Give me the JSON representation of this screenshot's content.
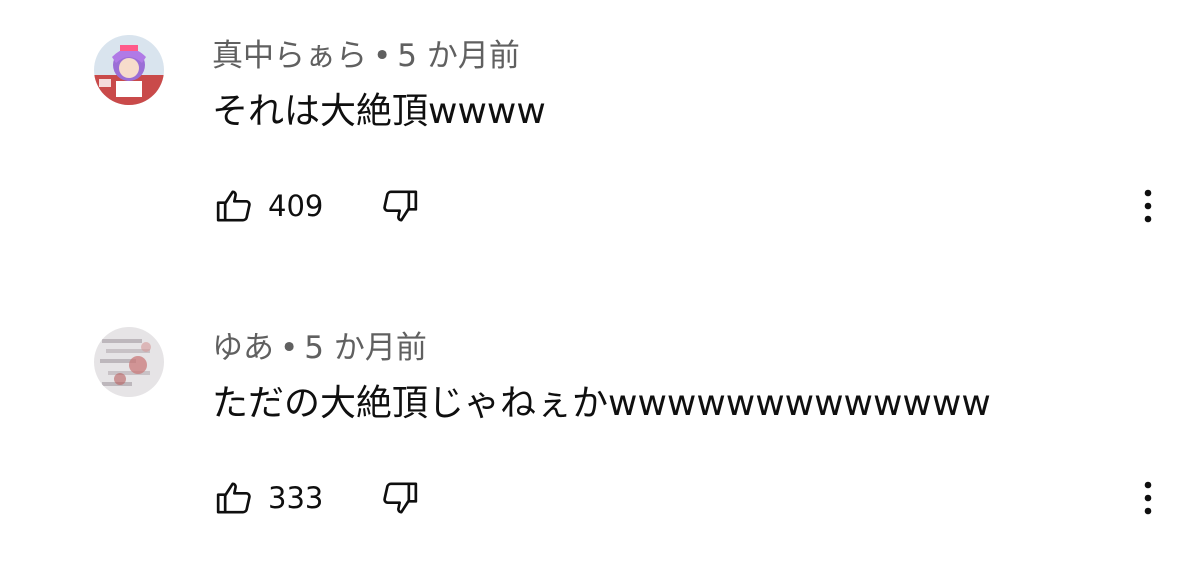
{
  "comments": [
    {
      "author": "真中らぁら",
      "separator": "•",
      "time": "5 か月前",
      "text": "それは大絶頂wwww",
      "likes": "409"
    },
    {
      "author": "ゆあ",
      "separator": "•",
      "time": "5 か月前",
      "text": "ただの大絶頂じゃねぇかwwwwwwwwwwwww",
      "likes": "333"
    }
  ],
  "icons": {
    "like": "thumbs-up-icon",
    "dislike": "thumbs-down-icon",
    "menu": "more-vert-icon"
  }
}
